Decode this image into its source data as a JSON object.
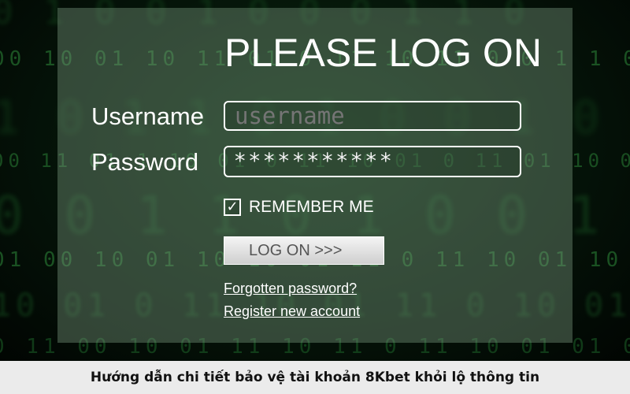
{
  "background": {
    "pattern_rows": [
      "0  1  0  0  1  0  0  0  1  1  0",
      "00  10  01  10  11  01  0  11  10  11  0  0  1  1  0  0  1  1  0  1",
      "1  0  1  1  0  1  0  0  1  0  1  1  0",
      "00  11  01  1  10  01  0  11  10  01  0  11  01  10  01  0  01  1  0",
      "0  0  1  1  0  1  0  0  1  1  0",
      "01  00  10  01  10  10  01  11  0  11  10  01  10  01  0  11  0  0",
      "10  01  0  11  10  01  11  0  10  01  1  0  10  01  0",
      "0  11  00  10  01  11  10  11  0  11  10  01  01  0  11  0  0"
    ]
  },
  "login": {
    "title": "PLEASE LOG ON",
    "username_label": "Username",
    "username_placeholder": "username",
    "password_label": "Password",
    "password_value": "***********",
    "remember_checked": true,
    "remember_mark": "✓",
    "remember_label": "REMEMBER ME",
    "submit_label": "LOG ON  >>>",
    "forgot_link": "Forgotten password?",
    "register_link": "Register new account"
  },
  "caption": "Hướng dẫn chi tiết bảo vệ tài khoản 8Kbet khỏi lộ thông tin",
  "colors": {
    "panel_overlay": "#78967d",
    "matrix_green": "#2e8a3a",
    "caption_bg": "#ebebeb"
  }
}
